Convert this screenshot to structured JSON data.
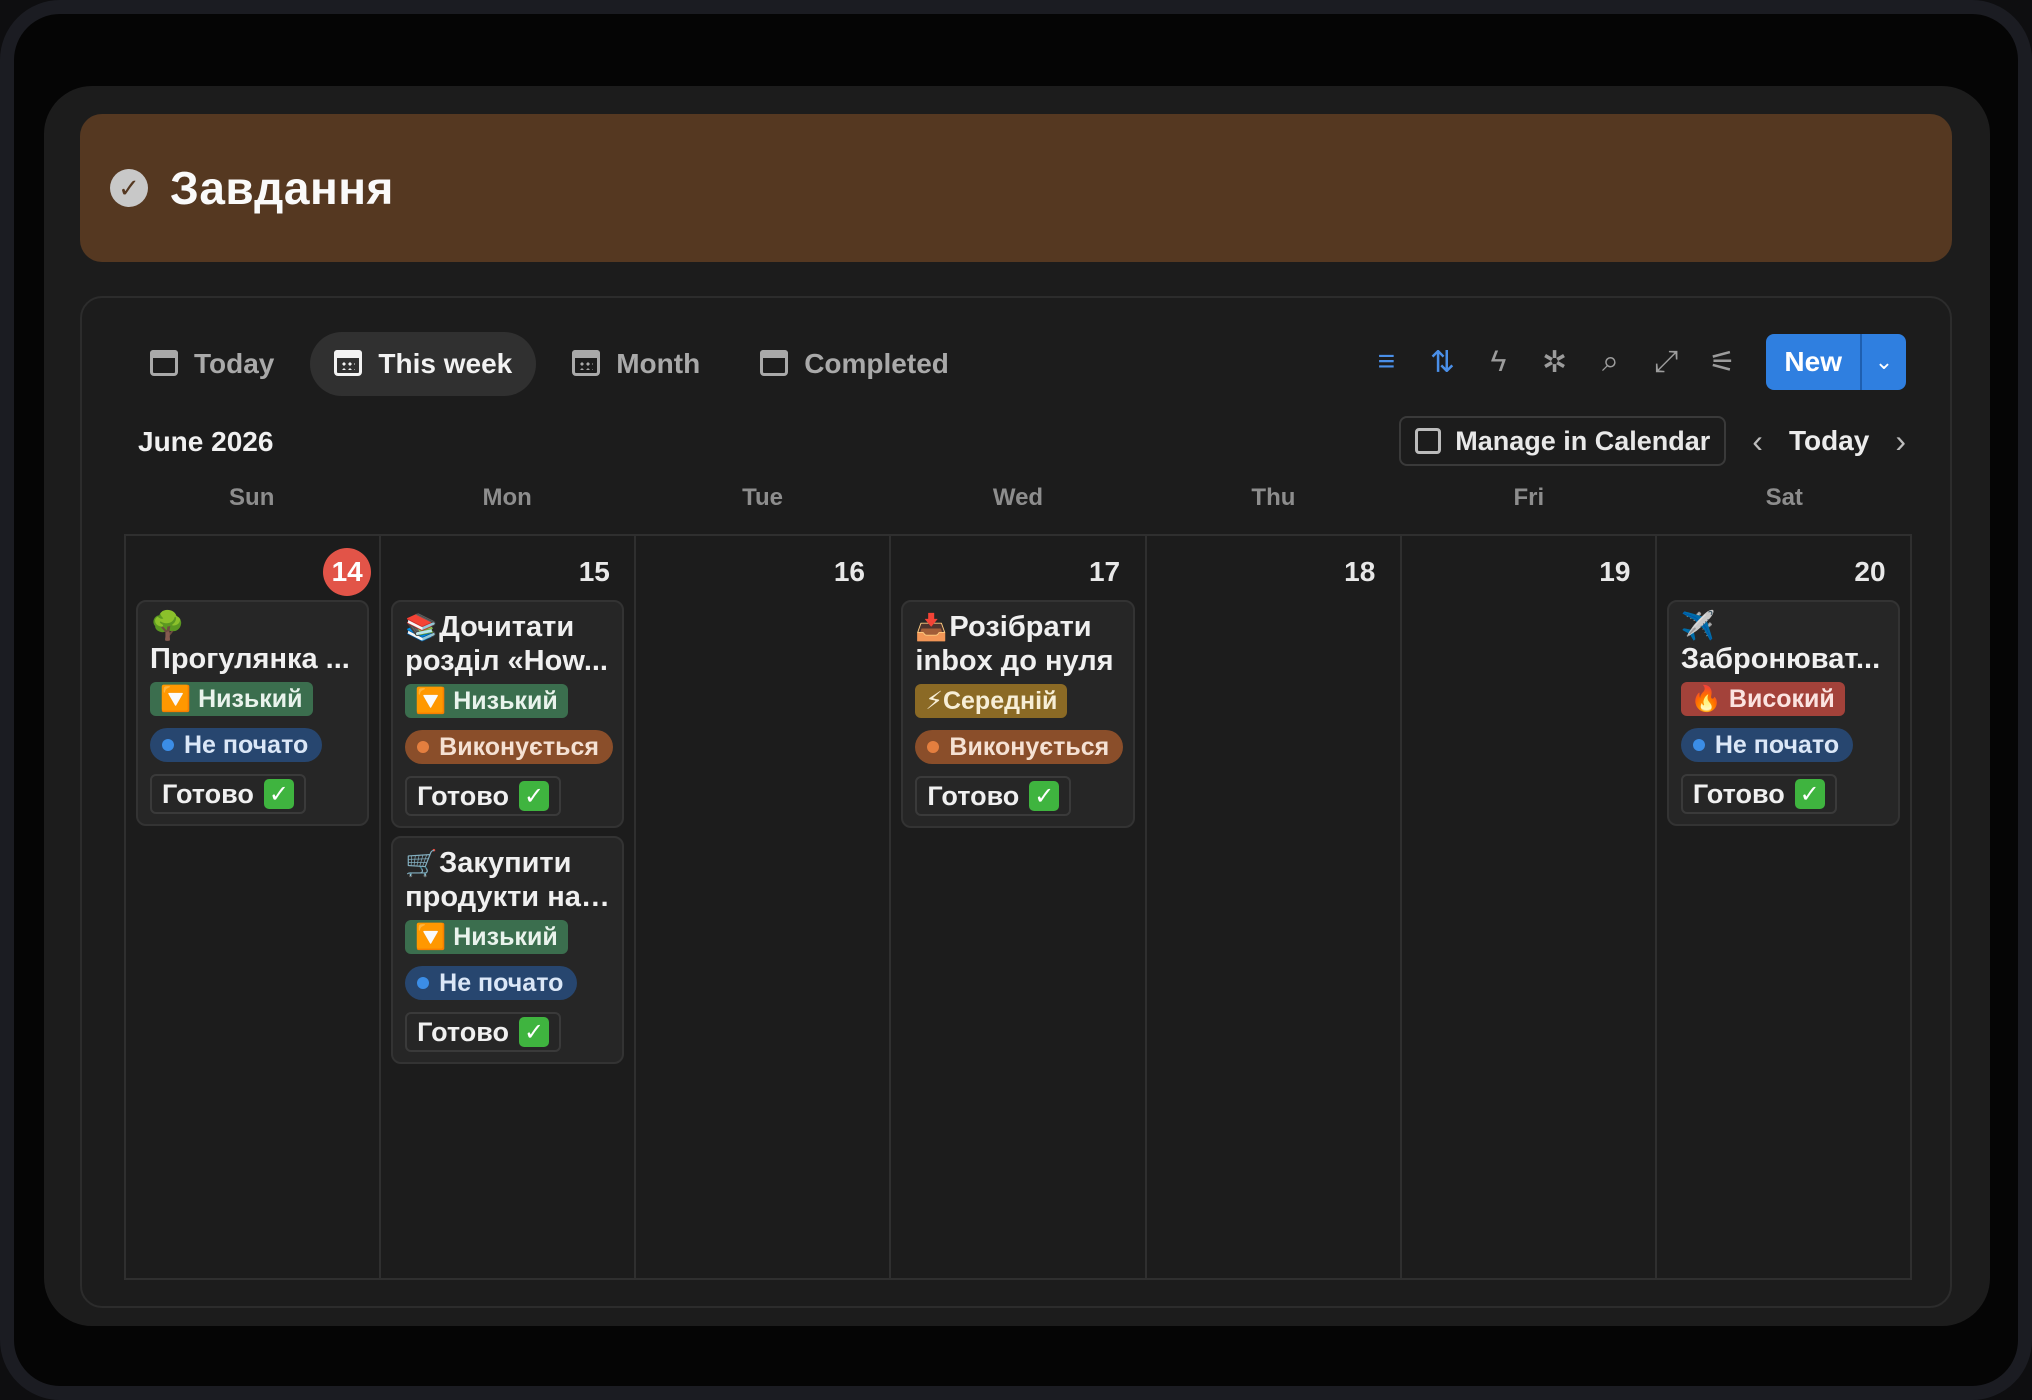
{
  "page": {
    "title": "Завдання",
    "title_icon": "check-circle-icon"
  },
  "tabs": [
    {
      "label": "Today",
      "icon": "calendar-icon",
      "active": false
    },
    {
      "label": "This week",
      "icon": "calendar-week-icon",
      "active": true
    },
    {
      "label": "Month",
      "icon": "calendar-month-icon",
      "active": false
    },
    {
      "label": "Completed",
      "icon": "calendar-icon",
      "active": false
    }
  ],
  "toolbar": {
    "tools": [
      "filter-icon",
      "sort-icon",
      "automation-icon",
      "ai-sparkle-icon",
      "search-icon",
      "expand-icon",
      "settings-icon"
    ],
    "new_label": "New"
  },
  "calendar": {
    "month_label": "June 2026",
    "manage_label": "Manage in Calendar",
    "today_label": "Today",
    "weekdays": [
      "Sun",
      "Mon",
      "Tue",
      "Wed",
      "Thu",
      "Fri",
      "Sat"
    ],
    "days": [
      "14",
      "15",
      "16",
      "17",
      "18",
      "19",
      "20"
    ],
    "today_day": "14"
  },
  "cards": {
    "walk": {
      "emoji": "🌳",
      "title": "Прогулянка ...",
      "priority": "🔽 Низький",
      "status": "Не почато",
      "done": "Готово"
    },
    "read": {
      "emoji": "📚",
      "title_l1": "Дочитати",
      "title_l2": "розділ «How...",
      "priority": "🔽 Низький",
      "status": "Виконується",
      "done": "Готово"
    },
    "shop": {
      "emoji": "🛒",
      "title_l1": "Закупити",
      "title_l2": "продукти на ...",
      "priority": "🔽 Низький",
      "status": "Не почато",
      "done": "Готово"
    },
    "inbox": {
      "emoji": "📥",
      "title_l1": "Розібрати",
      "title_l2": "inbox до нуля",
      "priority": "⚡Середній",
      "status": "Виконується",
      "done": "Готово"
    },
    "book": {
      "emoji": "✈️",
      "title": "Забронюват...",
      "priority": "🔥 Високий",
      "status": "Не почато",
      "done": "Готово"
    }
  },
  "colors": {
    "banner": "#553821",
    "accent": "#2f7fe0",
    "today_badge": "#e25448"
  }
}
